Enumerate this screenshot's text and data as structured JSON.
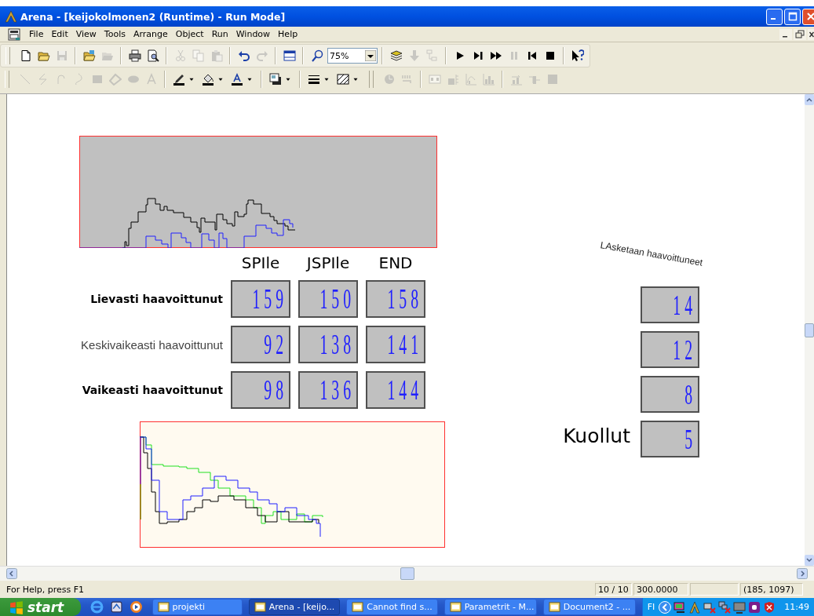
{
  "window": {
    "title": "Arena - [keijokolmonen2 (Runtime) - Run Mode]"
  },
  "menu": [
    "File",
    "Edit",
    "View",
    "Tools",
    "Arrange",
    "Object",
    "Run",
    "Window",
    "Help"
  ],
  "standard_toolbar": [
    {
      "disabled": false
    },
    {
      "disabled": false
    },
    {
      "disabled": true
    },
    {
      "disabled": false
    },
    {
      "disabled": true
    },
    {
      "disabled": false
    },
    {
      "disabled": false
    },
    {
      "disabled": true
    },
    {
      "disabled": true
    },
    {
      "disabled": true
    },
    {
      "disabled": false
    },
    {
      "disabled": true
    },
    {
      "disabled": false
    },
    {
      "disabled": false
    },
    {
      "disabled": false
    },
    {
      "disabled": true
    },
    {
      "disabled": true
    },
    {
      "disabled": false
    },
    {
      "disabled": false
    },
    {
      "disabled": false
    },
    {
      "disabled": true
    },
    {
      "disabled": false
    },
    {
      "disabled": false
    },
    {
      "disabled": false
    }
  ],
  "zoom": {
    "value": "75%"
  },
  "draw_toolbar": [
    {
      "disabled": true
    },
    {
      "disabled": true
    },
    {
      "disabled": true
    },
    {
      "disabled": true
    },
    {
      "disabled": true
    },
    {
      "disabled": true
    },
    {
      "disabled": true
    },
    {
      "disabled": true
    },
    {
      "disabled": false
    },
    {
      "disabled": false
    },
    {
      "disabled": false
    },
    {
      "disabled": false
    },
    {
      "disabled": false
    },
    {
      "disabled": false
    },
    {
      "disabled": false
    },
    {
      "disabled": false
    },
    {
      "disabled": false
    },
    {
      "disabled": false
    },
    {
      "disabled": false
    },
    {
      "disabled": false
    },
    {
      "disabled": true
    },
    {
      "disabled": true
    },
    {
      "disabled": true
    },
    {
      "disabled": true
    },
    {
      "disabled": true
    },
    {
      "disabled": true
    },
    {
      "disabled": true
    },
    {
      "disabled": true
    },
    {
      "disabled": true
    }
  ],
  "table": {
    "columns": [
      "SPIle",
      "JSPIle",
      "END"
    ],
    "rows": [
      {
        "label": "Lievasti haavoittunut",
        "bold": true,
        "values": [
          "159",
          "150",
          "158"
        ]
      },
      {
        "label": "Keskivaikeasti haavoittunut",
        "bold": false,
        "values": [
          "92",
          "138",
          "141"
        ]
      },
      {
        "label": "Vaikeasti haavoittunut",
        "bold": true,
        "values": [
          "98",
          "136",
          "144"
        ]
      }
    ]
  },
  "counters": {
    "title": "LAsketaan haavoittuneet",
    "values": [
      "14",
      "12",
      "8"
    ],
    "dead": {
      "label": "Kuollut",
      "value": "5"
    }
  },
  "status_bar": {
    "message": "For Help, press F1",
    "panels": [
      "10 / 10",
      "300.0000",
      "(185, 1097)"
    ]
  },
  "taskbar": {
    "start": "start",
    "tasks": [
      {
        "label": "projekti",
        "selected": false
      },
      {
        "label": "Arena - [keijo...",
        "selected": true
      },
      {
        "label": "Cannot find s...",
        "selected": false
      },
      {
        "label": "Parametrit - M...",
        "selected": false
      },
      {
        "label": "Document2 - ...",
        "selected": false
      }
    ],
    "language": "FI",
    "clock": "11:49"
  }
}
